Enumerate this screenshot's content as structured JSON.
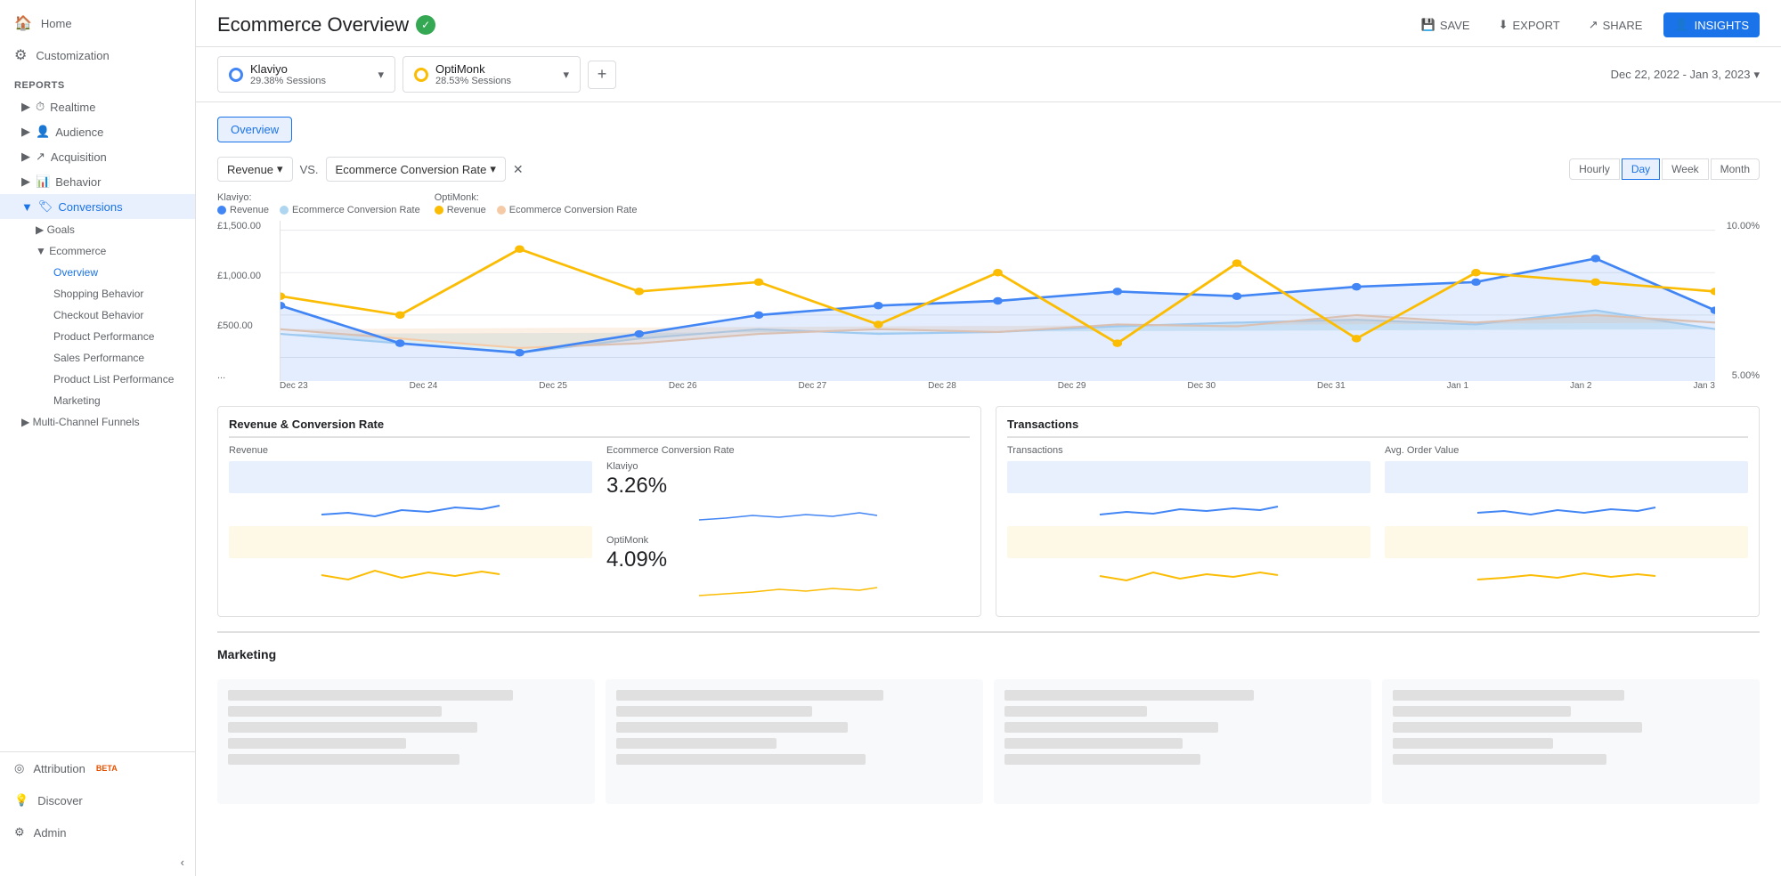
{
  "sidebar": {
    "nav_items": [
      {
        "label": "Home",
        "icon": "🏠"
      },
      {
        "label": "Customization",
        "icon": "⚙"
      }
    ],
    "reports_label": "REPORTS",
    "tree_items": [
      {
        "label": "Realtime",
        "icon": "⏱",
        "expanded": false
      },
      {
        "label": "Audience",
        "icon": "👤",
        "expanded": false
      },
      {
        "label": "Acquisition",
        "icon": "↗",
        "expanded": false
      },
      {
        "label": "Behavior",
        "icon": "📊",
        "expanded": false
      },
      {
        "label": "Conversions",
        "icon": "🏷",
        "expanded": true,
        "active": true
      }
    ],
    "conversions_children": [
      {
        "label": "Goals",
        "expanded": false
      },
      {
        "label": "Ecommerce",
        "expanded": true,
        "active": true
      }
    ],
    "ecommerce_children": [
      {
        "label": "Overview",
        "active": true
      },
      {
        "label": "Shopping Behavior"
      },
      {
        "label": "Checkout Behavior"
      },
      {
        "label": "Product Performance"
      },
      {
        "label": "Sales Performance"
      },
      {
        "label": "Product List Performance"
      },
      {
        "label": "Marketing"
      }
    ],
    "extra_items": [
      {
        "label": "Multi-Channel Funnels",
        "expanded": false
      }
    ],
    "bottom_items": [
      {
        "label": "Attribution",
        "icon": "◎",
        "beta": true
      },
      {
        "label": "Discover",
        "icon": "💡"
      },
      {
        "label": "Admin",
        "icon": "⚙"
      }
    ]
  },
  "header": {
    "title": "Ecommerce Overview",
    "verified": true
  },
  "topbar_actions": {
    "save": "SAVE",
    "export": "EXPORT",
    "share": "SHARE",
    "insights": "INSIGHTS"
  },
  "segments": [
    {
      "name": "Klaviyo",
      "sessions": "29.38% Sessions",
      "color": "#4285f4"
    },
    {
      "name": "OptiMonk",
      "sessions": "28.53% Sessions",
      "color": "#fbbc04"
    }
  ],
  "date_range": "Dec 22, 2022 - Jan 3, 2023",
  "tabs": [
    "Overview"
  ],
  "chart_controls": {
    "metric1": "Revenue",
    "vs_label": "VS.",
    "metric2": "Ecommerce Conversion Rate"
  },
  "time_buttons": [
    "Hourly",
    "Day",
    "Week",
    "Month"
  ],
  "active_time_button": "Day",
  "chart_legend": {
    "klaviyo_label": "Klaviyo:",
    "optimonk_label": "OptiMonk:",
    "items": [
      {
        "label": "Revenue",
        "color": "#4285f4",
        "filled": true
      },
      {
        "label": "Ecommerce Conversion Rate",
        "color": "#aed6f1",
        "filled": false
      }
    ],
    "items2": [
      {
        "label": "Revenue",
        "color": "#fbbc04",
        "filled": true
      },
      {
        "label": "Ecommerce Conversion Rate",
        "color": "#f5cba7",
        "filled": false
      }
    ]
  },
  "chart": {
    "yaxis_left": [
      "£1,500.00",
      "£1,000.00",
      "£500.00",
      "..."
    ],
    "yaxis_right": [
      "10.00%",
      "5.00%"
    ],
    "xaxis": [
      "Dec 23",
      "Dec 24",
      "Dec 25",
      "Dec 26",
      "Dec 27",
      "Dec 28",
      "Dec 29",
      "Dec 30",
      "Dec 31",
      "Jan 1",
      "Jan 2",
      "Jan 3"
    ]
  },
  "sections": {
    "revenue_conversion": "Revenue & Conversion Rate",
    "transactions": "Transactions",
    "marketing": "Marketing"
  },
  "metrics": {
    "revenue": {
      "label": "Revenue",
      "klaviyo_value": "",
      "optimonk_value": ""
    },
    "conversion_rate": {
      "label": "Ecommerce Conversion Rate",
      "klaviyo_label": "Klaviyo",
      "klaviyo_value": "3.26%",
      "optimonk_label": "OptiMonk",
      "optimonk_value": "4.09%"
    },
    "transactions": {
      "label": "Transactions"
    },
    "avg_order_value": {
      "label": "Avg. Order Value"
    }
  }
}
